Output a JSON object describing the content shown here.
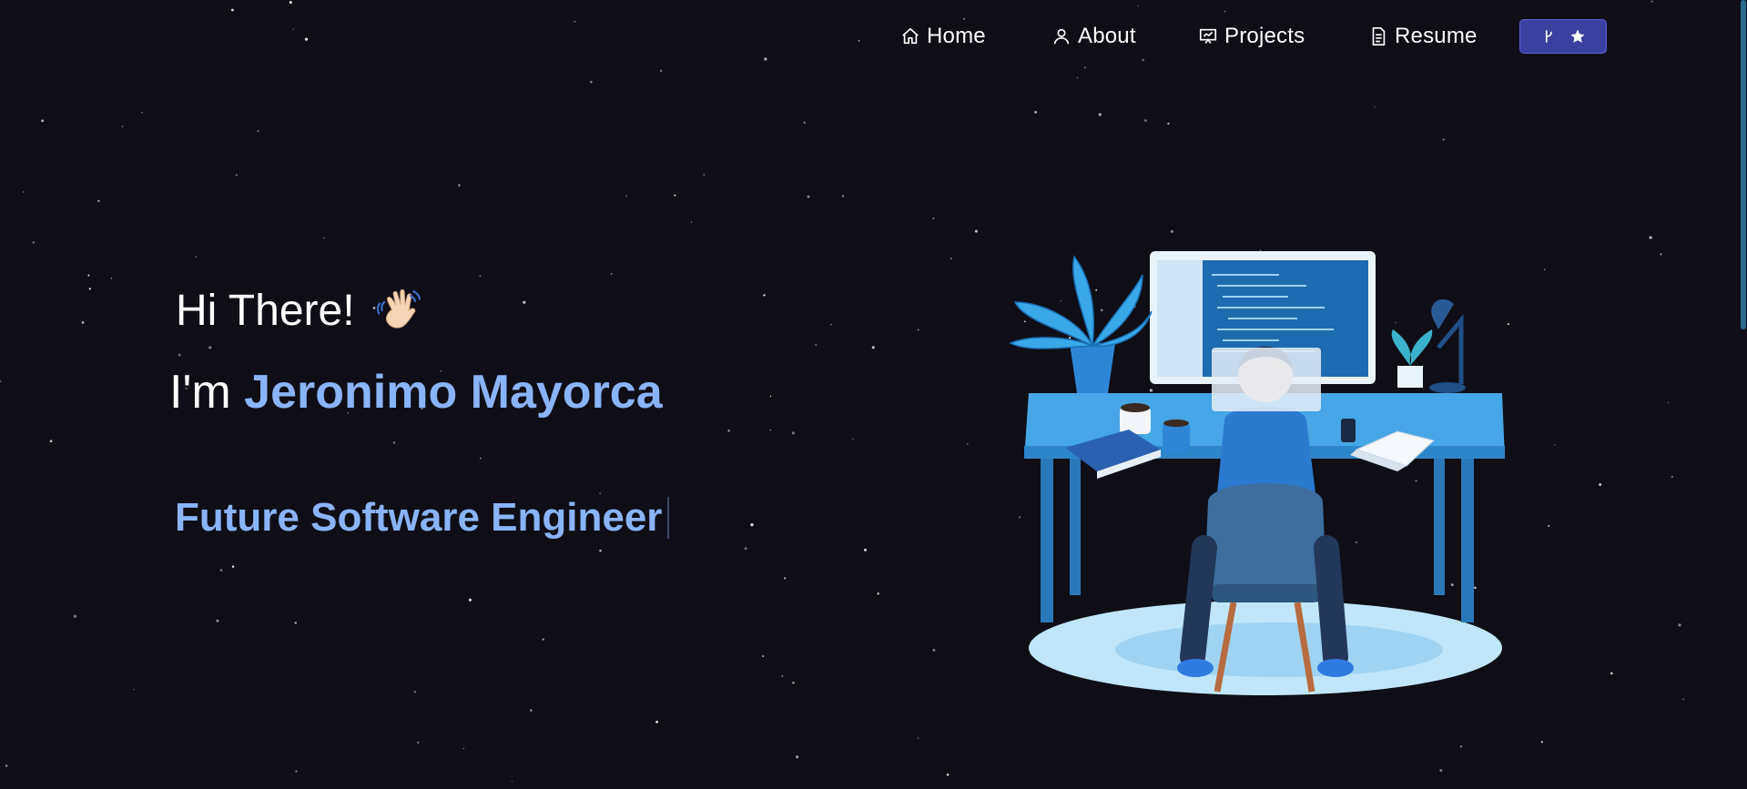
{
  "nav": {
    "items": [
      {
        "label": "Home",
        "icon": "home-icon"
      },
      {
        "label": "About",
        "icon": "user-icon"
      },
      {
        "label": "Projects",
        "icon": "presentation-icon"
      },
      {
        "label": "Resume",
        "icon": "document-icon"
      }
    ],
    "github_button": {
      "icons": [
        "fork-icon",
        "star-icon"
      ]
    }
  },
  "hero": {
    "greeting": "Hi There!",
    "intro_prefix": "I'm",
    "name": "Jeronimo Mayorca",
    "role": "Future Software Engineer"
  },
  "colors": {
    "background": "#0f0e17",
    "accent": "#8ab4f8",
    "button": "#3b3f9e"
  }
}
